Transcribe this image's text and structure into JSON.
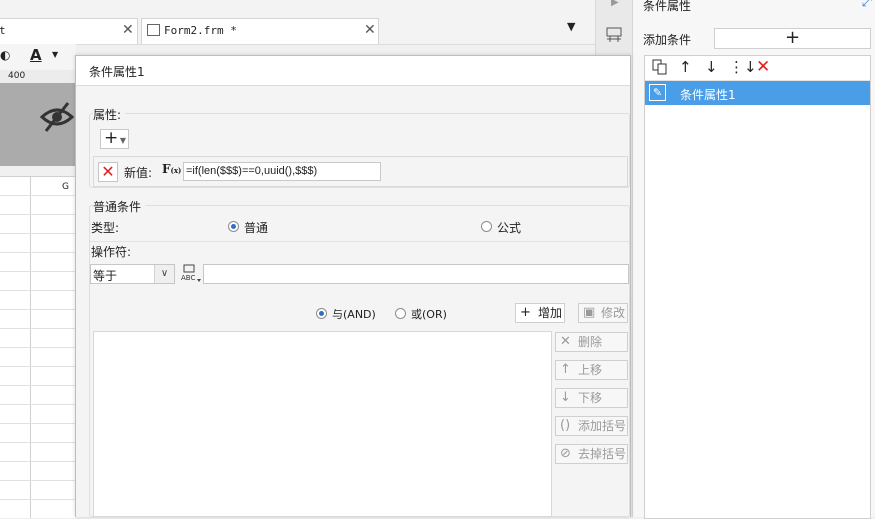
{
  "editor": {
    "tabs": [
      {
        "label": "t",
        "close": "✕"
      },
      {
        "label": "Form2.frm *",
        "close": "✕"
      }
    ],
    "ruler_label": "400",
    "column_header": "G"
  },
  "right_panel": {
    "title": "条件属性",
    "add_condition_label": "添加条件",
    "add_button": "+",
    "selected_item": "条件属性1"
  },
  "dialog": {
    "title": "条件属性1",
    "attributes": {
      "label": "属性:",
      "new_value_label": "新值:",
      "formula": "=if(len($$$)==0,uuid(),$$$)"
    },
    "common": {
      "label": "普通条件",
      "type_label": "类型:",
      "type_options": [
        "普通",
        "公式"
      ],
      "type_selected": "普通",
      "operator_label": "操作符:",
      "operator_value": "等于",
      "value_text": "",
      "logic_options": [
        "与(AND)",
        "或(OR)"
      ],
      "logic_selected": "与(AND)",
      "buttons": {
        "add": "增加",
        "modify": "修改",
        "delete": "删除",
        "up": "上移",
        "down": "下移",
        "add_paren": "添加括号",
        "remove_paren": "去掉括号"
      }
    }
  },
  "colors": {
    "selection_blue": "#4a9ee8",
    "delete_red": "#e02020",
    "expand_blue": "#2a7bd9"
  }
}
